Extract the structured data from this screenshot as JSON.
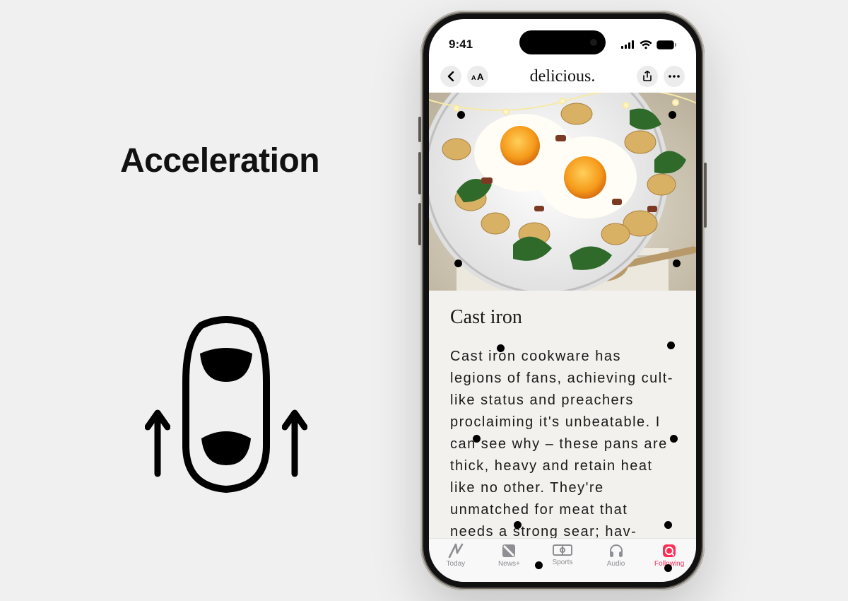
{
  "left": {
    "heading": "Acceleration",
    "icon": "car-top-acceleration"
  },
  "status": {
    "time": "9:41"
  },
  "navbar": {
    "brand": "delicious."
  },
  "article": {
    "title": "Cast iron",
    "body": "Cast iron cookware has legions of fans, achieving cult-like status and preachers proclaiming it's unbeatable. I can see why – these pans are thick, heavy and retain heat like no other. They're unmatched for meat that needs a strong sear; hav-"
  },
  "tabs": [
    {
      "label": "Today",
      "icon": "today-icon",
      "active": false
    },
    {
      "label": "News+",
      "icon": "newsplus-icon",
      "active": false
    },
    {
      "label": "Sports",
      "icon": "sports-icon",
      "active": false
    },
    {
      "label": "Audio",
      "icon": "audio-icon",
      "active": false
    },
    {
      "label": "Following",
      "icon": "following-icon",
      "active": true
    }
  ],
  "colors": {
    "accent": "#ff2d55"
  }
}
